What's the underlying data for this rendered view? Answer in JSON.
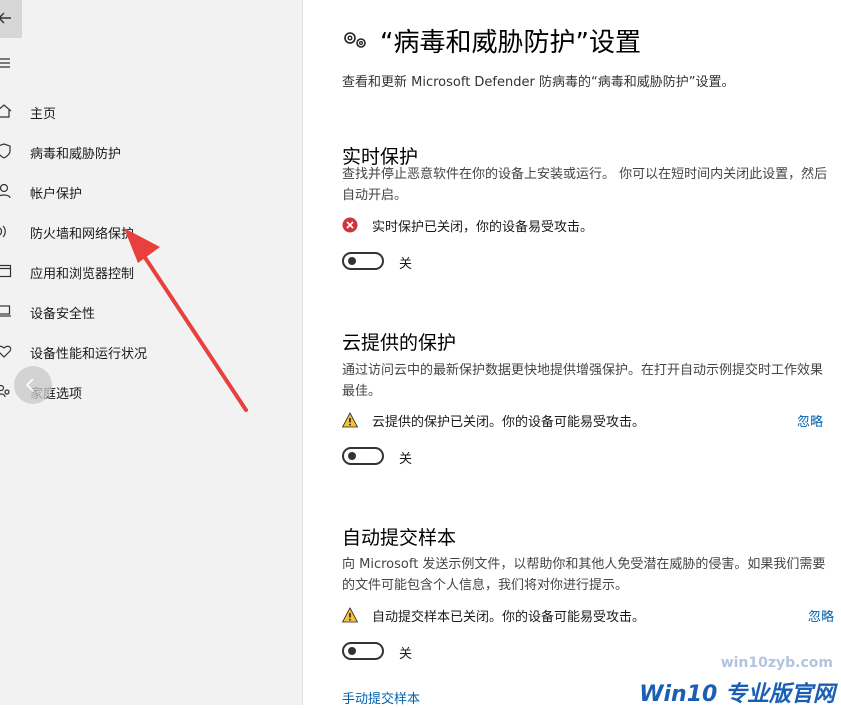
{
  "sidebar": {
    "items": [
      {
        "label": "主页",
        "icon": "home-icon"
      },
      {
        "label": "病毒和威胁防护",
        "icon": "shield-icon"
      },
      {
        "label": "帐户保护",
        "icon": "person-icon"
      },
      {
        "label": "防火墙和网络保护",
        "icon": "wifi-icon"
      },
      {
        "label": "应用和浏览器控制",
        "icon": "app-window-icon"
      },
      {
        "label": "设备安全性",
        "icon": "laptop-icon"
      },
      {
        "label": "设备性能和运行状况",
        "icon": "heart-icon"
      },
      {
        "label": "家庭选项",
        "icon": "family-icon"
      }
    ]
  },
  "main": {
    "title": "“病毒和威胁防护”设置",
    "description": "查看和更新 Microsoft Defender 防病毒的“病毒和威胁防护”设置。",
    "sections": [
      {
        "title": "实时保护",
        "description": "查找并停止恶意软件在你的设备上安装或运行。 你可以在短时间内关闭此设置，然后自动开启。",
        "status": "实时保护已关闭，你的设备易受攻击。",
        "status_type": "error",
        "toggle_label": "关"
      },
      {
        "title": "云提供的保护",
        "description": "通过访问云中的最新保护数据更快地提供增强保护。在打开自动示例提交时工作效果最佳。",
        "status": "云提供的保护已关闭。你的设备可能易受攻击。",
        "status_type": "warning",
        "ignore_label": "忽略",
        "toggle_label": "关"
      },
      {
        "title": "自动提交样本",
        "description": "向 Microsoft 发送示例文件，以帮助你和其他人免受潜在威胁的侵害。如果我们需要的文件可能包含个人信息，我们将对你进行提示。",
        "status": "自动提交样本已关闭。你的设备可能易受攻击。",
        "status_type": "warning",
        "ignore_label": "忽略",
        "toggle_label": "关"
      }
    ],
    "manual_link": "手动提交样本"
  },
  "watermark": {
    "site": "win10zyb.com",
    "logo": "Win10 专业版官网"
  },
  "colors": {
    "accent": "#0063b1",
    "error": "#d13438",
    "warning": "#f7c23b",
    "annotation_arrow": "#e8403c"
  }
}
